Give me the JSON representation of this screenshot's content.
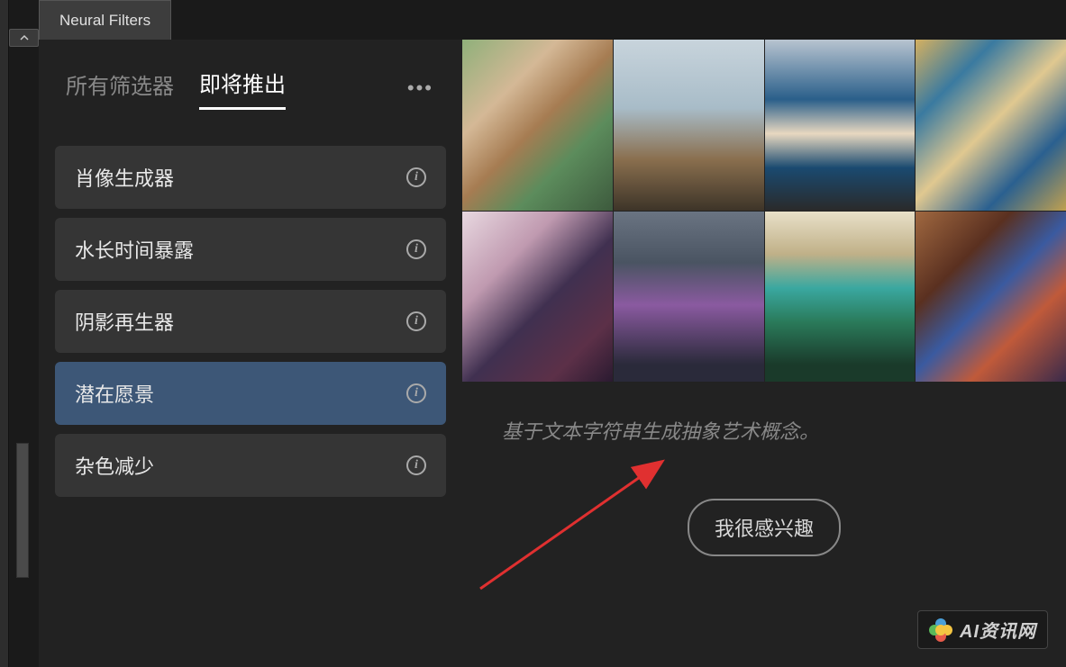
{
  "panel": {
    "tab_title": "Neural Filters"
  },
  "sub_tabs": {
    "all_filters": "所有筛选器",
    "coming_soon": "即将推出"
  },
  "filters": [
    {
      "label": "肖像生成器",
      "selected": false
    },
    {
      "label": "水长时间暴露",
      "selected": false
    },
    {
      "label": "阴影再生器",
      "selected": false
    },
    {
      "label": "潜在愿景",
      "selected": true
    },
    {
      "label": "杂色减少",
      "selected": false
    }
  ],
  "detail": {
    "description": "基于文本字符串生成抽象艺术概念。",
    "interest_button": "我很感兴趣"
  },
  "watermark": {
    "text": "AI资讯网"
  }
}
